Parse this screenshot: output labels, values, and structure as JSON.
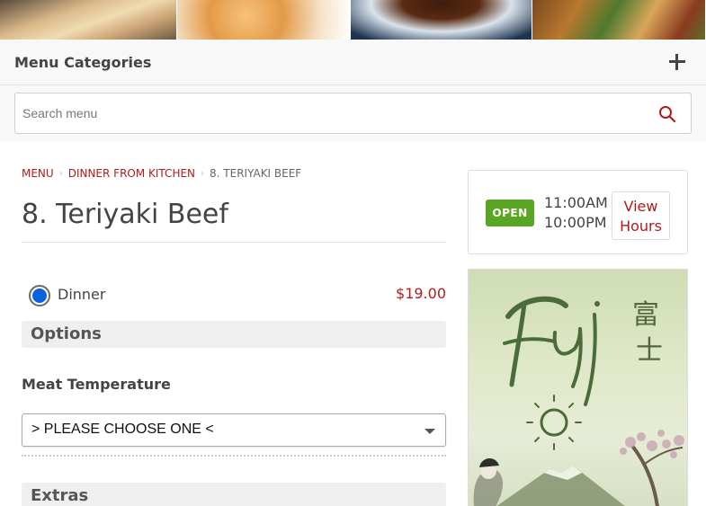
{
  "banner": {
    "photos": [
      "dumplings-photo",
      "tempura-photo",
      "sauce-photo",
      "stir-fry-photo"
    ]
  },
  "categories": {
    "title": "Menu Categories",
    "toggle_icon": "plus-icon"
  },
  "search": {
    "placeholder": "Search menu",
    "value": "",
    "icon": "search-icon"
  },
  "breadcrumb": {
    "items": [
      "MENU",
      "DINNER FROM KITCHEN",
      "8. TERIYAKI BEEF"
    ]
  },
  "item": {
    "title": "8. Teriyaki Beef",
    "size_label": "Dinner",
    "price": "$19.00",
    "size_selected": true
  },
  "options": {
    "section_title": "Options",
    "groups": [
      {
        "label": "Meat Temperature",
        "selected": "> PLEASE CHOOSE ONE <"
      }
    ],
    "extras_title": "Extras"
  },
  "hours": {
    "status": "OPEN",
    "line1": "11:00AM -",
    "line2": "10:00PM",
    "button_line1": "View",
    "button_line2": "Hours"
  },
  "brand": {
    "logo_text": "Fuji",
    "kanji": "富士"
  },
  "colors": {
    "accent_red": "#b01c1c",
    "open_green": "#5aa523",
    "radio_blue": "#0a62e0"
  }
}
